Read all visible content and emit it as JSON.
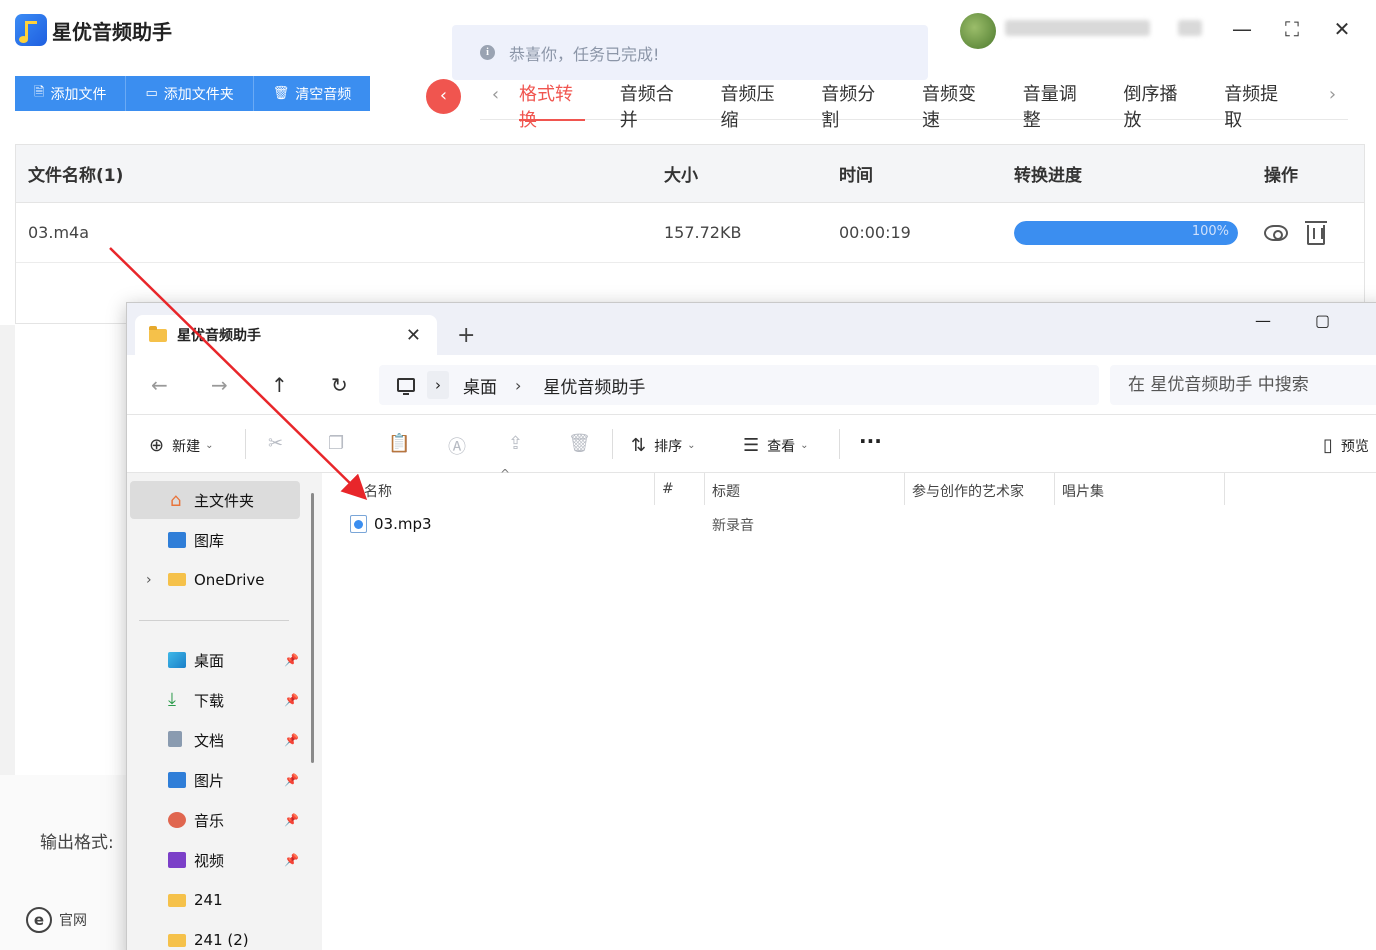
{
  "app": {
    "title": "星优音频助手",
    "toast": "恭喜你，任务已完成!",
    "toolbar": [
      {
        "label": "添加文件",
        "icon": "file-icon"
      },
      {
        "label": "添加文件夹",
        "icon": "folder-icon"
      },
      {
        "label": "清空音频",
        "icon": "trash-icon"
      }
    ],
    "tabs": [
      "格式转换",
      "音频合并",
      "音频压缩",
      "音频分割",
      "音频变速",
      "音量调整",
      "倒序播放",
      "音频提取"
    ],
    "active_tab": "格式转换",
    "table": {
      "headers": {
        "name": "文件名称(1)",
        "size": "大小",
        "time": "时间",
        "progress": "转换进度",
        "ops": "操作"
      },
      "rows": [
        {
          "name": "03.m4a",
          "size": "157.72KB",
          "time": "00:00:19",
          "progress_text": "100%",
          "progress": 1.0
        }
      ]
    },
    "output_label": "输出格式:",
    "website_label": "官网",
    "colors": {
      "accent": "#3b8ef0",
      "active_tab": "#f0554f"
    }
  },
  "explorer": {
    "tab_title": "星优音频助手",
    "path": [
      "桌面",
      "星优音频助手"
    ],
    "search_placeholder": "在 星优音频助手 中搜索",
    "commands": {
      "new": "新建",
      "sort": "排序",
      "view": "查看",
      "preview": "预览"
    },
    "nav": {
      "home": "主文件夹",
      "gallery": "图库",
      "onedrive": "OneDrive",
      "desktop": "桌面",
      "downloads": "下载",
      "documents": "文档",
      "pictures": "图片",
      "music": "音乐",
      "videos": "视频",
      "f241": "241",
      "f241b": "241 (2)"
    },
    "columns": {
      "name": "名称",
      "num": "#",
      "title": "标题",
      "artist": "参与创作的艺术家",
      "album": "唱片集"
    },
    "files": [
      {
        "name": "03.mp3",
        "title": "新录音"
      }
    ]
  }
}
